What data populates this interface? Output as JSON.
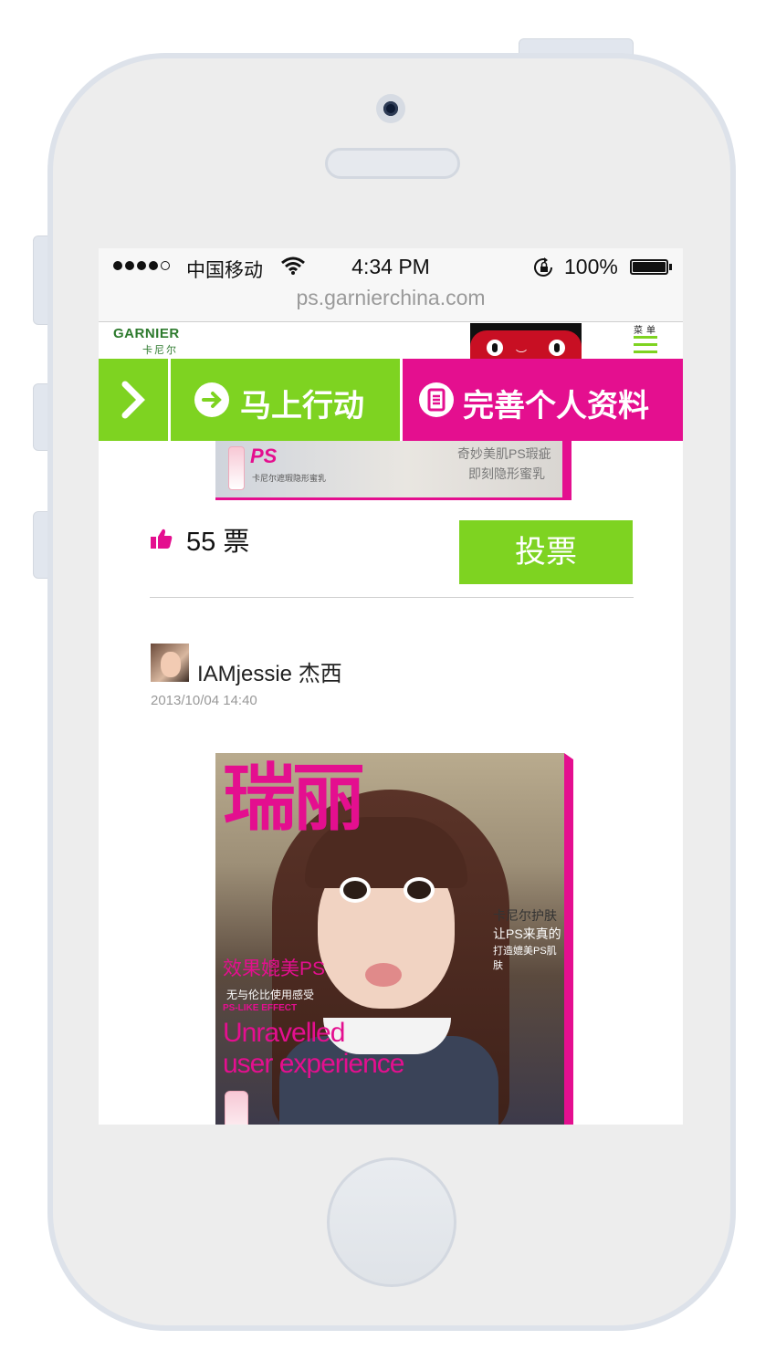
{
  "statusbar": {
    "carrier": "中国移动",
    "time": "4:34 PM",
    "battery_pct": "100%"
  },
  "browser": {
    "url": "ps.garnierchina.com"
  },
  "header": {
    "logo_text": "GARNIER",
    "logo_cn": "卡尼尔",
    "menu_label": "菜单",
    "icons": [
      "garnier-logo",
      "tmall-cat-logo",
      "hamburger-menu-icon"
    ]
  },
  "actions": {
    "go_label": "马上行动",
    "profile_label": "完善个人资料",
    "colors": {
      "green": "#7ed321",
      "magenta": "#e40f8f"
    }
  },
  "prev_post": {
    "poster_ps": "PS",
    "poster_sub": "卡尼尔遮瑕隐形蜜乳",
    "poster_line1": "奇妙美肌PS瑕疵",
    "poster_line2": "即刻隐形蜜乳",
    "votes": "55 票",
    "vote_button": "投票"
  },
  "post": {
    "author": "IAMjessie 杰西",
    "date": "2013/10/04   14:40",
    "cover": {
      "title": "瑞丽",
      "right_line1": "卡尼尔护肤",
      "right_line2": "让PS来真的",
      "right_line3": "打造媲美PS肌肤",
      "effect": "效果媲美PS",
      "small": "无与伦比使用感受",
      "en_small": "PS-LIKE EFFECT",
      "en_line1": "Unravelled",
      "en_line2": "user experience"
    }
  }
}
